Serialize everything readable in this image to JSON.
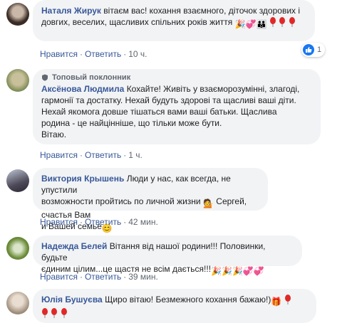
{
  "comments": [
    {
      "author": "Наталя Жирук",
      "text": "вітаєм вас! кохання взаємного, діточок здорових і довгих, веселих, щасливих спільних років життя",
      "actions": {
        "like": "Нравится",
        "reply": "Ответить",
        "time": "10 ч."
      },
      "reaction_count": "1"
    },
    {
      "badge": "Топовый поклонник",
      "author": "Аксёнова Людмила",
      "text_lines": [
        "Кохайте! Живіть у взаєморозумінні, злагоді,",
        "гармонії та достатку. Нехай будуть здорові та щасливі ваші діти.",
        "Нехай якомога довше тішаться вами ваші батьки. Щаслива",
        "родина - це найцінніше, що тільки може бути.",
        "Вітаю."
      ],
      "actions": {
        "like": "Нравится",
        "reply": "Ответить",
        "time": "1 ч."
      }
    },
    {
      "author": "Виктория Крышень",
      "text_a": "Люди у нас, как всегда, не упустили",
      "text_b": "возможности пройтись по личной жизни",
      "text_c": "Сергей, счастья Вам",
      "text_d": "и Вашей семье",
      "actions": {
        "like": "Нравится",
        "reply": "Ответить",
        "time": "42 мин."
      }
    },
    {
      "author": "Надежда Белей",
      "text_a": "Вітання від нашої родини!!! Половинки, будьте",
      "text_b": "єдиним цілим...це щастя не всім дається!!!",
      "actions": {
        "like": "Нравится",
        "reply": "Ответить",
        "time": "39 мин."
      }
    },
    {
      "author": "Юлія Бушуєва",
      "text": "Щиро вітаю! Безмежного кохання бажаю!)"
    }
  ],
  "colors": {
    "name": "#385898",
    "bubble": "#f2f3f5",
    "meta": "#606770",
    "like_badge": "#1877f2"
  },
  "icons": [
    "party-popper-icon",
    "hearts-icon",
    "family-icon",
    "balloon-icon",
    "person-gesture-icon",
    "smile-icon",
    "gift-icon",
    "thumbs-up-icon",
    "shield-icon"
  ]
}
